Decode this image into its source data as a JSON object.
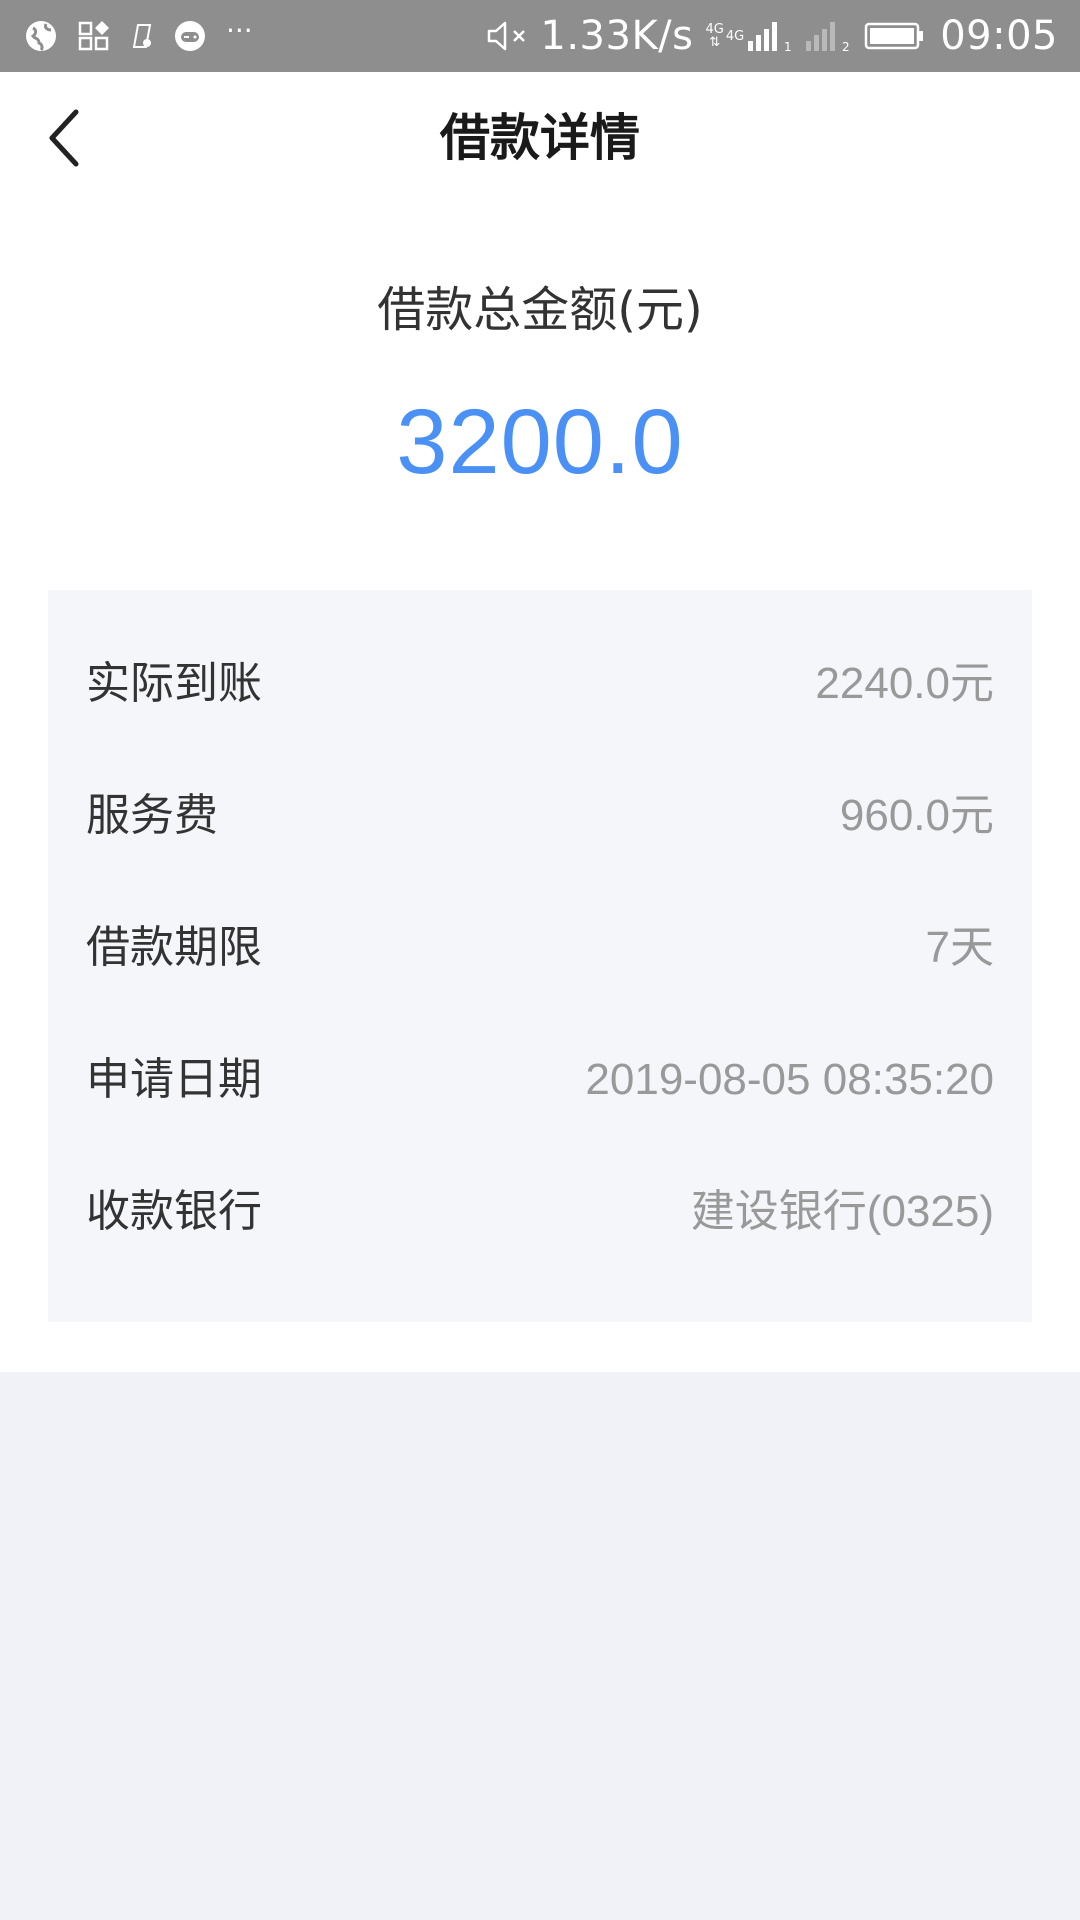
{
  "status_bar": {
    "icons_left": [
      "globe-icon",
      "apps-icon",
      "sim-icon",
      "gamepad-icon"
    ],
    "more": "···",
    "mute_icon": "speaker-mute-icon",
    "network_speed": "1.33K/s",
    "net_type_1": "4G",
    "net_type_2": "4G",
    "sim1_label": "1",
    "sim2_label": "2",
    "battery_icon": "battery-icon",
    "time": "09:05"
  },
  "header": {
    "back_icon": "chevron-left-icon",
    "title": "借款详情"
  },
  "summary": {
    "label": "借款总金额(元)",
    "amount": "3200.0"
  },
  "details": {
    "rows": [
      {
        "label": "实际到账",
        "value": "2240.0元"
      },
      {
        "label": "服务费",
        "value": "960.0元"
      },
      {
        "label": "借款期限",
        "value": "7天"
      },
      {
        "label": "申请日期",
        "value": "2019-08-05 08:35:20"
      },
      {
        "label": "收款银行",
        "value": "建设银行(0325)"
      }
    ]
  },
  "colors": {
    "accent": "#4a90f5",
    "status_bar": "#8e8e8e",
    "card_bg": "#f5f6fa",
    "page_bg": "#f0f2f7",
    "value_text": "#999999",
    "label_text": "#333333"
  }
}
